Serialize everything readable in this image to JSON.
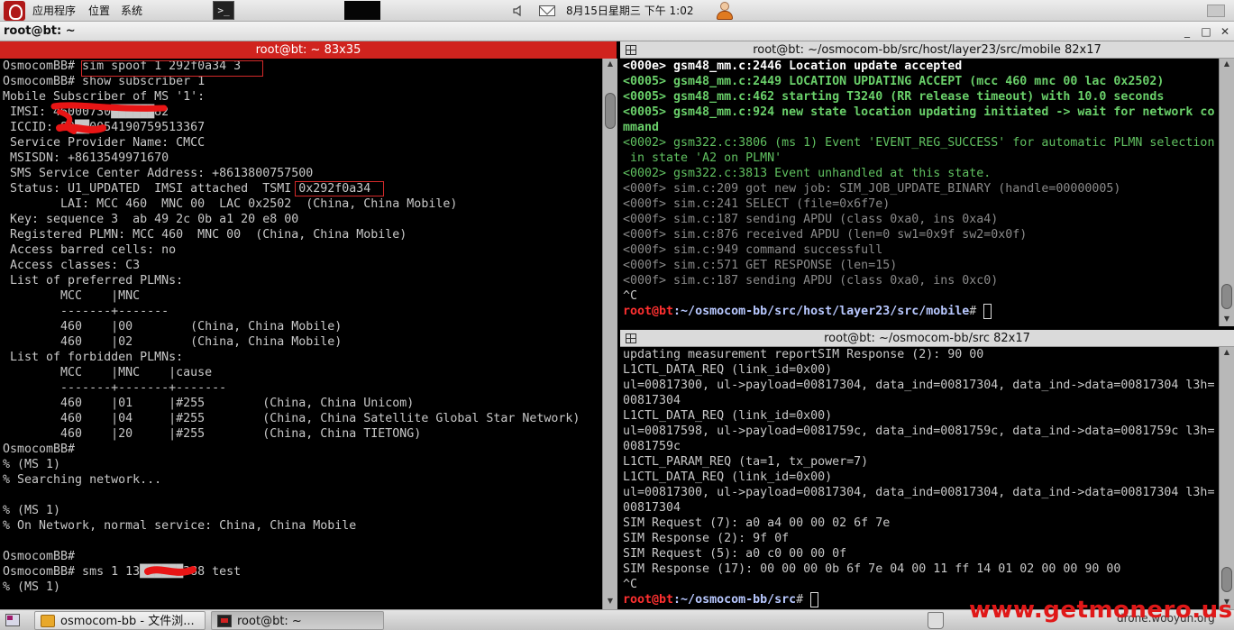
{
  "top_panel": {
    "menu_apps": "应用程序",
    "menu_places": "位置",
    "menu_system": "系统",
    "terminal_launcher_glyph": ">_",
    "clock": "8月15日星期三 下午  1:02"
  },
  "window": {
    "title": "root@bt: ~",
    "minimize_glyph": "_",
    "maximize_glyph": "□",
    "close_glyph": "✕"
  },
  "left_pane": {
    "title": "root@bt: ~ 83x35",
    "lines": [
      "OsmocomBB# sim spoof 1 292f0a34 3",
      "OsmocomBB# show subscriber 1",
      "Mobile Subscriber of MS '1':",
      " IMSI: 46000730██████82",
      " ICCID: 89██0054190759513367",
      " Service Provider Name: CMCC",
      " MSISDN: +8613549971670",
      " SMS Service Center Address: +8613800757500",
      " Status: U1_UPDATED  IMSI attached  TSMI 0x292f0a34",
      "        LAI: MCC 460  MNC 00  LAC 0x2502  (China, China Mobile)",
      " Key: sequence 3  ab 49 2c 0b a1 20 e8 00",
      " Registered PLMN: MCC 460  MNC 00  (China, China Mobile)",
      " Access barred cells: no",
      " Access classes: C3",
      " List of preferred PLMNs:",
      "        MCC    |MNC",
      "        -------+-------",
      "        460    |00        (China, China Mobile)",
      "        460    |02        (China, China Mobile)",
      " List of forbidden PLMNs:",
      "        MCC    |MNC    |cause",
      "        -------+-------+-------",
      "        460    |01     |#255        (China, China Unicom)",
      "        460    |04     |#255        (China, China Satellite Global Star Network)",
      "        460    |20     |#255        (China, China TIETONG)",
      "OsmocomBB#",
      "% (MS 1)",
      "% Searching network...",
      "",
      "% (MS 1)",
      "% On Network, normal service: China, China Mobile",
      "",
      "OsmocomBB#",
      "OsmocomBB# sms 1 13██████388 test",
      "% (MS 1)"
    ]
  },
  "right_top_pane": {
    "title": "root@bt: ~/osmocom-bb/src/host/layer23/src/mobile 82x17",
    "lines": [
      {
        "t": "<000e> gsm48_mm.c:2446 Location update accepted",
        "c": "b"
      },
      {
        "t": "<0005> gsm48_mm.c:2449 LOCATION UPDATING ACCEPT (mcc 460 mnc 00 lac 0x2502)",
        "c": "g"
      },
      {
        "t": "<0005> gsm48_mm.c:462 starting T3240 (RR release timeout) with 10.0 seconds",
        "c": "g"
      },
      {
        "t": "<0005> gsm48_mm.c:924 new state location updating initiated -> wait for network co",
        "c": "g"
      },
      {
        "t": "mmand",
        "c": "g"
      },
      {
        "t": "<0002> gsm322.c:3806 (ms 1) Event 'EVENT_REG_SUCCESS' for automatic PLMN selection",
        "c": "gd"
      },
      {
        "t": " in state 'A2 on PLMN'",
        "c": "gd"
      },
      {
        "t": "<0002> gsm322.c:3813 Event unhandled at this state.",
        "c": "gd"
      },
      {
        "t": "<000f> sim.c:209 got new job: SIM_JOB_UPDATE_BINARY (handle=00000005)",
        "c": "gr"
      },
      {
        "t": "<000f> sim.c:241 SELECT (file=0x6f7e)",
        "c": "gr"
      },
      {
        "t": "<000f> sim.c:187 sending APDU (class 0xa0, ins 0xa4)",
        "c": "gr"
      },
      {
        "t": "<000f> sim.c:876 received APDU (len=0 sw1=0x9f sw2=0x0f)",
        "c": "gr"
      },
      {
        "t": "<000f> sim.c:949 command successfull",
        "c": "gr"
      },
      {
        "t": "<000f> sim.c:571 GET RESPONSE (len=15)",
        "c": "gr"
      },
      {
        "t": "<000f> sim.c:187 sending APDU (class 0xa0, ins 0xc0)",
        "c": "gr"
      },
      {
        "t": "^C",
        "c": ""
      }
    ],
    "prompt_user": "root@bt",
    "prompt_path": ":~/osmocom-bb/src/host/layer23/src/mobile",
    "prompt_symbol": "# "
  },
  "right_bottom_pane": {
    "title": "root@bt: ~/osmocom-bb/src 82x17",
    "lines": [
      "updating measurement reportSIM Response (2): 90 00",
      "L1CTL_DATA_REQ (link_id=0x00)",
      "ul=00817300, ul->payload=00817304, data_ind=00817304, data_ind->data=00817304 l3h=",
      "00817304",
      "L1CTL_DATA_REQ (link_id=0x00)",
      "ul=00817598, ul->payload=0081759c, data_ind=0081759c, data_ind->data=0081759c l3h=",
      "0081759c",
      "L1CTL_PARAM_REQ (ta=1, tx_power=7)",
      "L1CTL_DATA_REQ (link_id=0x00)",
      "ul=00817300, ul->payload=00817304, data_ind=00817304, data_ind->data=00817304 l3h=",
      "00817304",
      "SIM Request (7): a0 a4 00 00 02 6f 7e",
      "SIM Response (2): 9f 0f",
      "SIM Request (5): a0 c0 00 00 0f",
      "SIM Response (17): 00 00 00 0b 6f 7e 04 00 11 ff 14 01 02 00 00 90 00",
      "^C"
    ],
    "prompt_user": "root@bt",
    "prompt_path": ":~/osmocom-bb/src",
    "prompt_symbol": "# "
  },
  "taskbar": {
    "task_filebrowser": "osmocom-bb - 文件浏...",
    "task_terminal": "root@bt: ~",
    "tray_text": "drone.wooyun.org"
  },
  "watermark": "www.getmonero.us",
  "colors": {
    "active_title": "#d0231e",
    "annotation_red": "#d42a2a",
    "log_green": "#6ad06a",
    "log_gray": "#8a8a8a",
    "prompt_red": "#ff3030"
  }
}
